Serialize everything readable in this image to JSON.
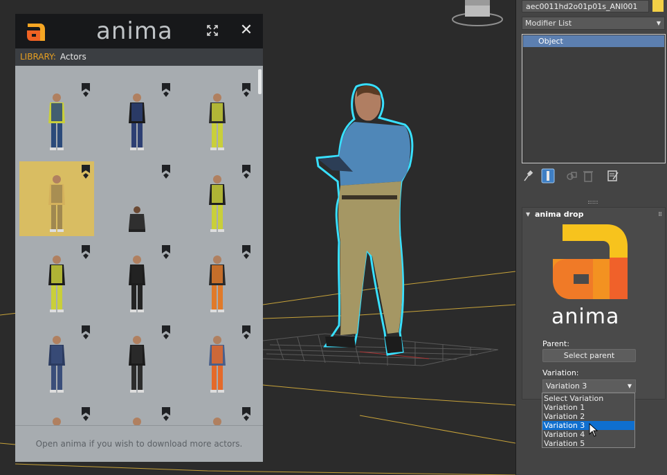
{
  "library": {
    "brand": "anima",
    "crumb_key": "LIBRARY:",
    "crumb_value": "Actors",
    "footer": "Open anima if you wish to download more actors.",
    "selected_tile": 3,
    "tile_count": 15
  },
  "command_panel": {
    "object_name": "aec0011hd2o01p01s_ANI001",
    "object_color": "#f3d046",
    "modifier_list": "Modifier List",
    "stack_items": [
      "Object"
    ],
    "rollout_title": "anima drop",
    "brand": "anima",
    "parent_label": "Parent:",
    "parent_button": "Select parent",
    "variation_label": "Variation:",
    "variation_value": "Variation 3",
    "variation_options": [
      "Select Variation",
      "Variation 1",
      "Variation 2",
      "Variation 3",
      "Variation 4",
      "Variation 5"
    ],
    "variation_selected_index": 3
  },
  "colors": {
    "accent_orange": "#e8a020",
    "selection_blue": "#0f6fcf",
    "tile_highlight": "#d9bd62",
    "outline_cyan": "#38e0ff"
  },
  "icons": [
    "anima-logo-icon",
    "expand-icon",
    "close-icon",
    "bookmark-icon",
    "pin-icon",
    "modifier-stack-icon",
    "make-unique-icon",
    "remove-modifier-icon",
    "configure-modifier-sets-icon",
    "viewcube-icon",
    "cursor-icon"
  ]
}
